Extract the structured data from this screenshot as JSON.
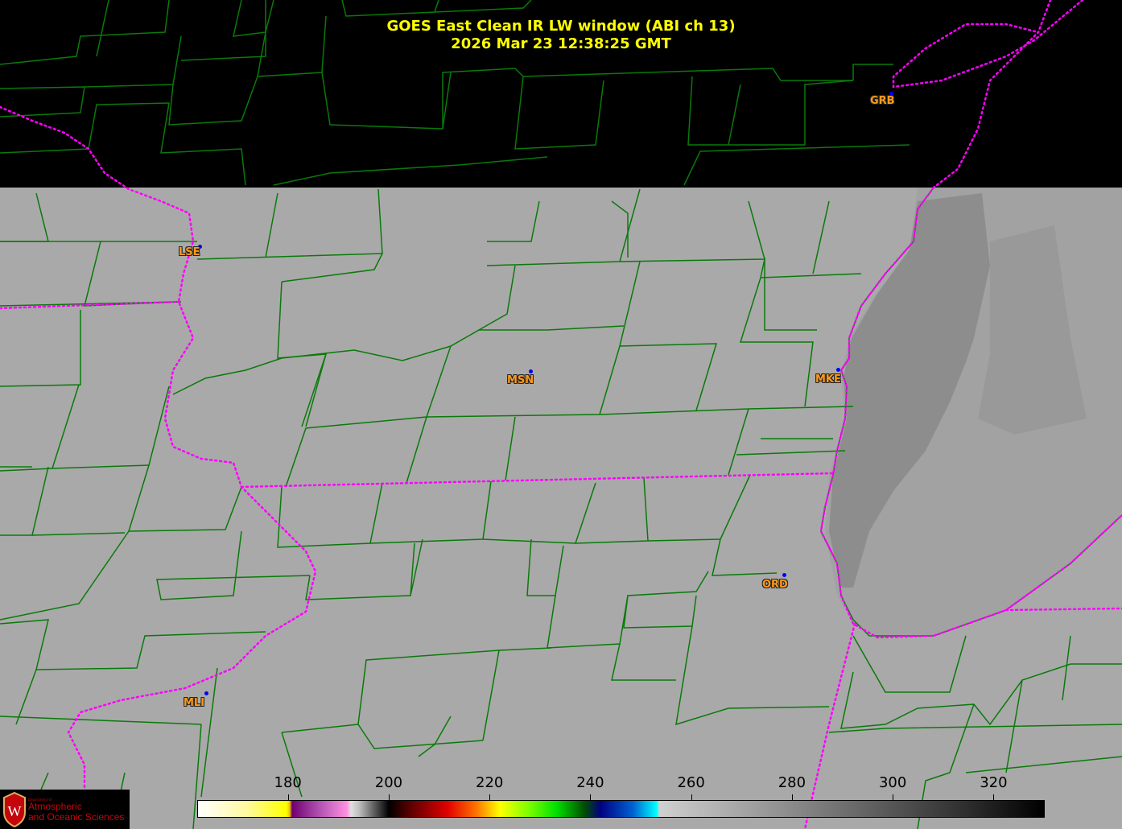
{
  "title": {
    "line1": "GOES East Clean IR LW window (ABI ch 13)",
    "line2": "2026 Mar 23  12:38:25 GMT"
  },
  "stations": [
    {
      "id": "GRB"
    },
    {
      "id": "LSE"
    },
    {
      "id": "MSN"
    },
    {
      "id": "MKE"
    },
    {
      "id": "ORD"
    },
    {
      "id": "MLI"
    }
  ],
  "colorbar": {
    "units_range": [
      162,
      330
    ],
    "ticks": [
      "180",
      "200",
      "220",
      "240",
      "260",
      "280",
      "300",
      "320"
    ]
  },
  "logo": {
    "dept_of": "Department of",
    "name_line1": "Atmospheric",
    "name_line2": "and Oceanic Sciences"
  },
  "colors": {
    "title": "#ffff00",
    "county_lines": "#0a7a0a",
    "state_lines": "#ff00ff",
    "station_label": "#ff9a1a",
    "station_dot": "#0000ff"
  }
}
